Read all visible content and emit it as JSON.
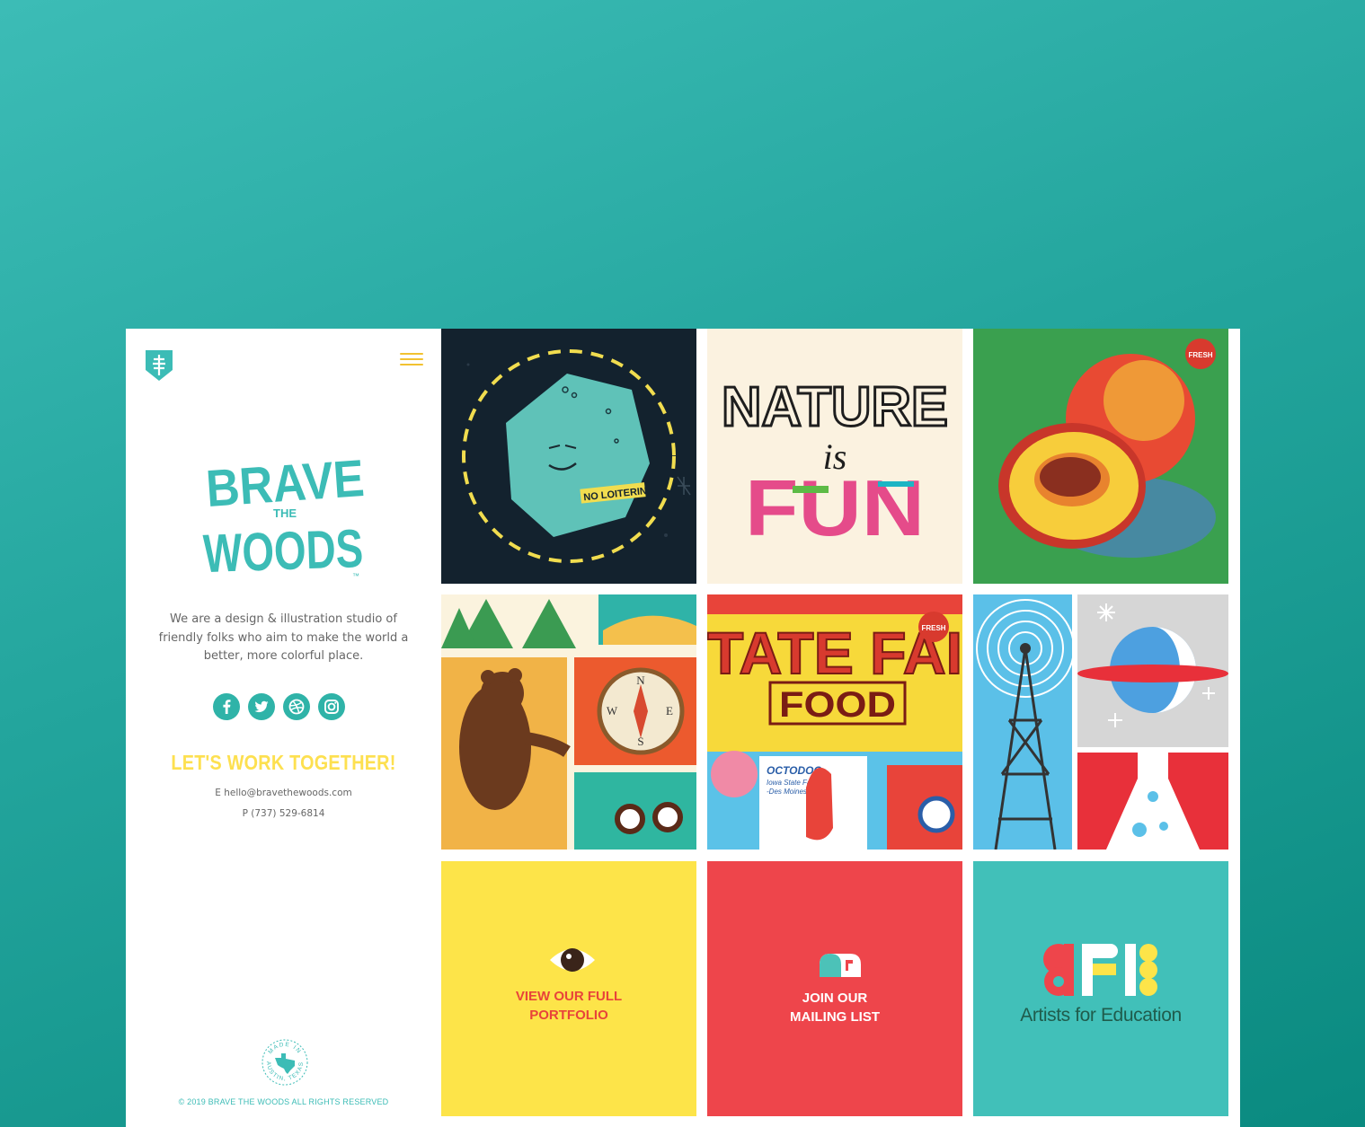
{
  "brand": {
    "logo_line1": "BRAVE",
    "logo_line2": "THE",
    "logo_line3": "WOODS",
    "tm": "™",
    "primary_color": "#3cbcb6",
    "accent_color": "#fde050"
  },
  "nav": {
    "menu_icon": "hamburger-icon"
  },
  "sidebar": {
    "tagline": "We are a design & illustration studio of friendly folks who aim to make the world a better, more colorful place.",
    "socials": [
      {
        "name": "facebook",
        "icon": "facebook-icon"
      },
      {
        "name": "twitter",
        "icon": "twitter-icon"
      },
      {
        "name": "dribbble",
        "icon": "dribbble-icon"
      },
      {
        "name": "instagram",
        "icon": "instagram-icon"
      }
    ],
    "cta": "LET'S WORK TOGETHER!",
    "email": "E hello@bravethewoods.com",
    "phone": "P (737) 529-6814",
    "badge_text_top": "MADE IN",
    "badge_text_bottom": "AUSTIN, TEXAS",
    "copyright": "© 2019 BRAVE THE WOODS ALL RIGHTS RESERVED"
  },
  "tiles": {
    "rock_sign": "NO LOITERIN",
    "nature_word1": "NATURE",
    "nature_word2": "is",
    "nature_word3": "FUN",
    "peach_badge": "FRESH",
    "fair_title": "TATE FAI",
    "fair_food": "FOOD",
    "fair_badge": "FRESH",
    "fair_sub1": "OCTODOG",
    "fair_sub2": "Iowa State Fair",
    "fair_sub3": "-Des Moines",
    "compass_n": "N",
    "compass_w": "W",
    "compass_e": "E",
    "compass_s": "S",
    "portfolio_line1": "VIEW OUR FULL",
    "portfolio_line2": "PORTFOLIO",
    "mailing_line1": "JOIN OUR",
    "mailing_line2": "MAILING LIST",
    "afe_name": "Artists for Education"
  }
}
